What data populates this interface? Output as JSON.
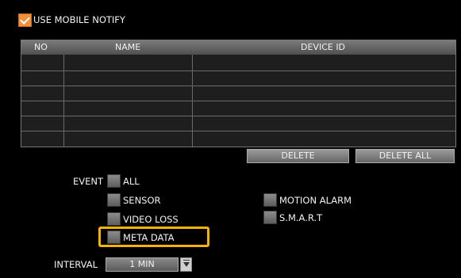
{
  "header": {
    "use_mobile_notify_label": "USE MOBILE NOTIFY",
    "use_mobile_notify_checked": true
  },
  "table": {
    "columns": [
      "NO",
      "NAME",
      "DEVICE ID"
    ],
    "rows": [
      [
        "",
        "",
        ""
      ],
      [
        "",
        "",
        ""
      ],
      [
        "",
        "",
        ""
      ],
      [
        "",
        "",
        ""
      ],
      [
        "",
        "",
        ""
      ],
      [
        "",
        "",
        ""
      ]
    ]
  },
  "buttons": {
    "delete": "DELETE",
    "delete_all": "DELETE ALL"
  },
  "event": {
    "label": "EVENT",
    "options": {
      "all": "ALL",
      "sensor": "SENSOR",
      "video_loss": "VIDEO LOSS",
      "meta_data": "META DATA",
      "motion_alarm": "MOTION ALARM",
      "smart": "S.M.A.R.T"
    }
  },
  "interval": {
    "label": "INTERVAL",
    "value": "1 MIN"
  },
  "colors": {
    "checkbox_checked": "#f0903a",
    "highlight": "#f5b400"
  }
}
